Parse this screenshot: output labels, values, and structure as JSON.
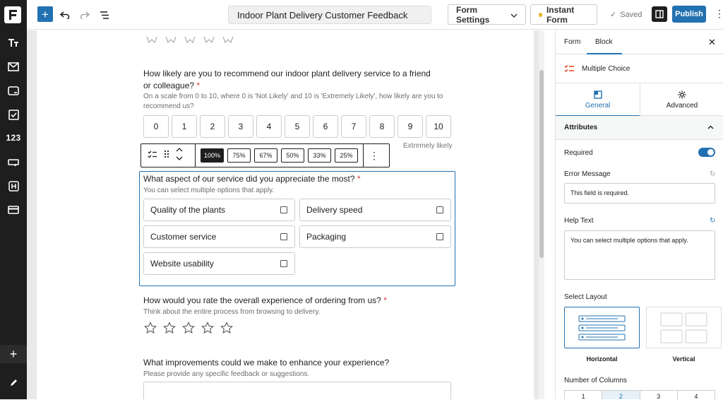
{
  "topbar": {
    "form_title": "Indoor Plant Delivery Customer Feedback",
    "form_settings": "Form Settings",
    "instant_form": "Instant Form",
    "saved": "Saved",
    "publish": "Publish"
  },
  "rail": {
    "numbers_label": "123"
  },
  "canvas": {
    "q_recommend": "How likely are you to recommend our indoor plant delivery service to a friend or colleague?",
    "q_recommend_help": "On a scale from 0 to 10, where 0 is 'Not Likely' and 10 is 'Extremely Likely', how likely are you to recommend us?",
    "nps": [
      "0",
      "1",
      "2",
      "3",
      "4",
      "5",
      "6",
      "7",
      "8",
      "9",
      "10"
    ],
    "extremely_likely": "Extremely likely",
    "widths": [
      "100%",
      "75%",
      "67%",
      "50%",
      "33%",
      "25%"
    ],
    "q_aspect": "What aspect of our service did you appreciate the most?",
    "q_aspect_help": "You can select multiple options that apply.",
    "options": [
      "Quality of the plants",
      "Delivery speed",
      "Customer service",
      "Packaging",
      "Website usability"
    ],
    "q_rate": "How would you rate the overall experience of ordering from us?",
    "q_rate_help": "Think about the entire process from browsing to delivery.",
    "q_improve": "What improvements could we make to enhance your experience?",
    "q_improve_help": "Please provide any specific feedback or suggestions.",
    "required_mark": "*"
  },
  "panel": {
    "tab_form": "Form",
    "tab_block": "Block",
    "block_name": "Multiple Choice",
    "sub_general": "General",
    "sub_advanced": "Advanced",
    "attributes": "Attributes",
    "required": "Required",
    "error_message_label": "Error Message",
    "error_message_value": "This field is required.",
    "help_text_label": "Help Text",
    "help_text_value": "You can select multiple options that apply.",
    "select_layout": "Select Layout",
    "layout_horizontal": "Horizontal",
    "layout_vertical": "Vertical",
    "number_of_columns": "Number of Columns",
    "columns": [
      "1",
      "2",
      "3",
      "4"
    ]
  },
  "colors": {
    "accent": "#2271b1",
    "dark": "#1e1e1e",
    "required": "#d63638"
  }
}
